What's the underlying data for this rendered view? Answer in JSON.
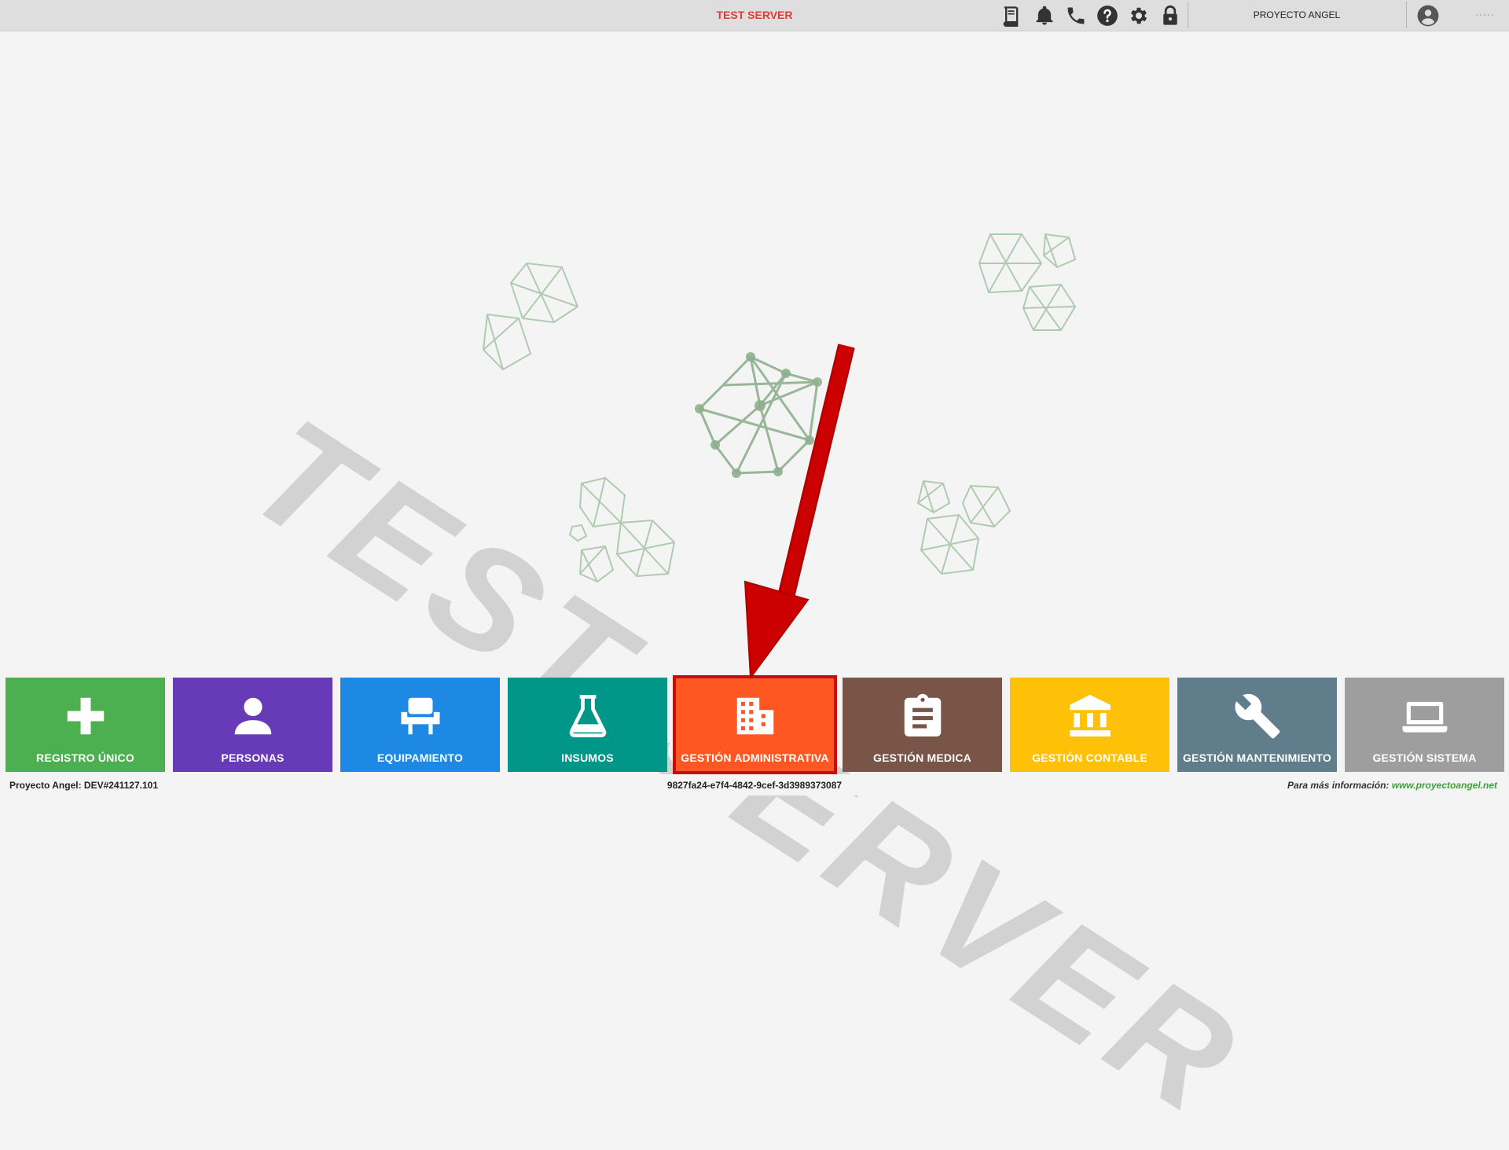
{
  "header": {
    "server_title": "TEST SERVER",
    "project_name": "PROYECTO ANGEL",
    "icons": [
      "book-icon",
      "bell-icon",
      "phone-icon",
      "help-icon",
      "gear-icon",
      "lock-icon",
      "user-circle-icon"
    ]
  },
  "watermark": {
    "text": "TEST SERVER"
  },
  "tiles": [
    {
      "label": "REGISTRO ÚNICO",
      "color": "#4caf50",
      "icon": "plus-icon"
    },
    {
      "label": "PERSONAS",
      "color": "#673ab7",
      "icon": "person-icon"
    },
    {
      "label": "EQUIPAMIENTO",
      "color": "#1e88e5",
      "icon": "chair-icon"
    },
    {
      "label": "INSUMOS",
      "color": "#009688",
      "icon": "flask-icon"
    },
    {
      "label": "GESTIÓN ADMINISTRATIVA",
      "color": "#ff5722",
      "icon": "building-icon",
      "highlighted": true
    },
    {
      "label": "GESTIÓN MEDICA",
      "color": "#795548",
      "icon": "clipboard-icon"
    },
    {
      "label": "GESTIÓN CONTABLE",
      "color": "#ffc107",
      "icon": "bank-icon"
    },
    {
      "label": "GESTIÓN MANTENIMIENTO",
      "color": "#607d8b",
      "icon": "wrench-icon"
    },
    {
      "label": "GESTIÓN SISTEMA",
      "color": "#9e9e9e",
      "icon": "laptop-icon"
    }
  ],
  "footer": {
    "version": "Proyecto Angel: DEV#241127.101",
    "session_id": "9827fa24-e7f4-4842-9cef-3d3989373087",
    "info_prefix": "Para más información:",
    "info_link": "www.proyectoangel.net"
  },
  "annotation": {
    "arrow_color": "#cc0000"
  }
}
